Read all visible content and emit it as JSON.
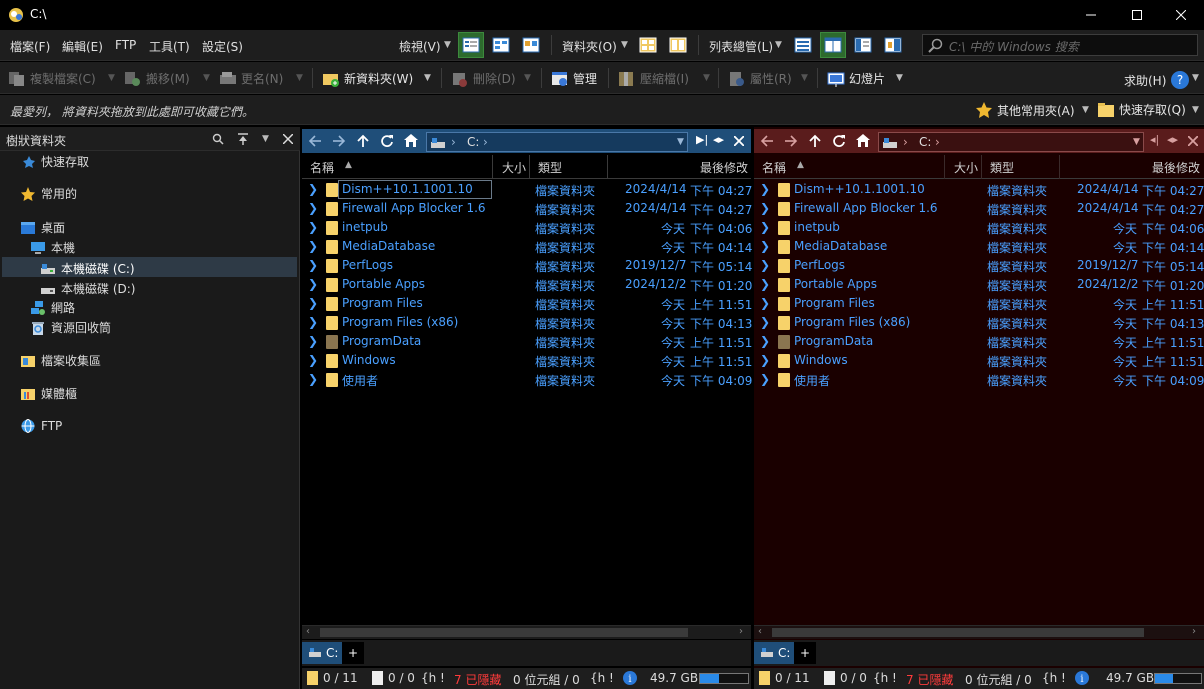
{
  "window": {
    "title": "C:\\"
  },
  "menu": {
    "file": "檔案(F)",
    "edit": "編輯(E)",
    "ftp": "FTP",
    "tools": "工具(T)",
    "settings": "設定(S)",
    "view": "檢視(V)",
    "folders": "資料夾(O)",
    "list_manager": "列表總管(L)",
    "search_placeholder": "C:\\ 中的 Windows 搜索"
  },
  "toolbar": {
    "copy": "複製檔案(C)",
    "move": "搬移(M)",
    "rename": "更名(N)",
    "new_folder": "新資料夾(W)",
    "delete": "刪除(D)",
    "manage": "管理",
    "archive": "壓縮檔(I)",
    "properties": "屬性(R)",
    "slideshow": "幻燈片",
    "help": "求助(H)"
  },
  "favbar": {
    "hint": "最愛列， 將資料夾拖放到此處即可收藏它們。",
    "other_favorites": "其他常用夾(A)",
    "quick_access": "快速存取(Q)"
  },
  "tree": {
    "header": "樹狀資料夾",
    "items": [
      {
        "label": "快速存取"
      },
      {
        "label": "常用的"
      },
      {
        "label": "桌面"
      },
      {
        "label": "本機"
      },
      {
        "label": "本機磁碟 (C:)"
      },
      {
        "label": "本機磁碟 (D:)"
      },
      {
        "label": "網路"
      },
      {
        "label": "資源回收筒"
      },
      {
        "label": "檔案收集區"
      },
      {
        "label": "媒體櫃"
      },
      {
        "label": "FTP"
      }
    ]
  },
  "lister": {
    "path": "C:",
    "columns": {
      "name": "名稱",
      "size": "大小",
      "type": "類型",
      "modified": "最後修改"
    },
    "tab_label": "C:",
    "files": [
      {
        "name": "Dism++10.1.1001.10",
        "type": "檔案資料夾",
        "date": "2024/4/14",
        "time": "下午 04:27"
      },
      {
        "name": "Firewall App Blocker 1.6",
        "type": "檔案資料夾",
        "date": "2024/4/14",
        "time": "下午 04:27"
      },
      {
        "name": "inetpub",
        "type": "檔案資料夾",
        "date": "今天",
        "time": "下午 04:06"
      },
      {
        "name": "MediaDatabase",
        "type": "檔案資料夾",
        "date": "今天",
        "time": "下午 04:14"
      },
      {
        "name": "PerfLogs",
        "type": "檔案資料夾",
        "date": "2019/12/7",
        "time": "下午 05:14"
      },
      {
        "name": "Portable Apps",
        "type": "檔案資料夾",
        "date": "2024/12/2",
        "time": "下午 01:20"
      },
      {
        "name": "Program Files",
        "type": "檔案資料夾",
        "date": "今天",
        "time": "上午 11:51"
      },
      {
        "name": "Program Files (x86)",
        "type": "檔案資料夾",
        "date": "今天",
        "time": "下午 04:13"
      },
      {
        "name": "ProgramData",
        "type": "檔案資料夾",
        "date": "今天",
        "time": "上午 11:51"
      },
      {
        "name": "Windows",
        "type": "檔案資料夾",
        "date": "今天",
        "time": "上午 11:51"
      },
      {
        "name": "使用者",
        "type": "檔案資料夾",
        "date": "今天",
        "time": "下午 04:09"
      }
    ],
    "status": {
      "folders": "0 / 11",
      "files": "0 / 0",
      "hidden_marker": "{h !",
      "hidden": "7 已隱藏",
      "bytes": "0 位元組 / 0",
      "hidden_marker2": "{h !",
      "free": "49.7 GB",
      "free_fraction": 0.4
    }
  },
  "colors": {
    "left_pane_header": "#1f4e79",
    "right_pane_header": "#5a1c1c",
    "right_pane_bg": "#1a0000"
  }
}
